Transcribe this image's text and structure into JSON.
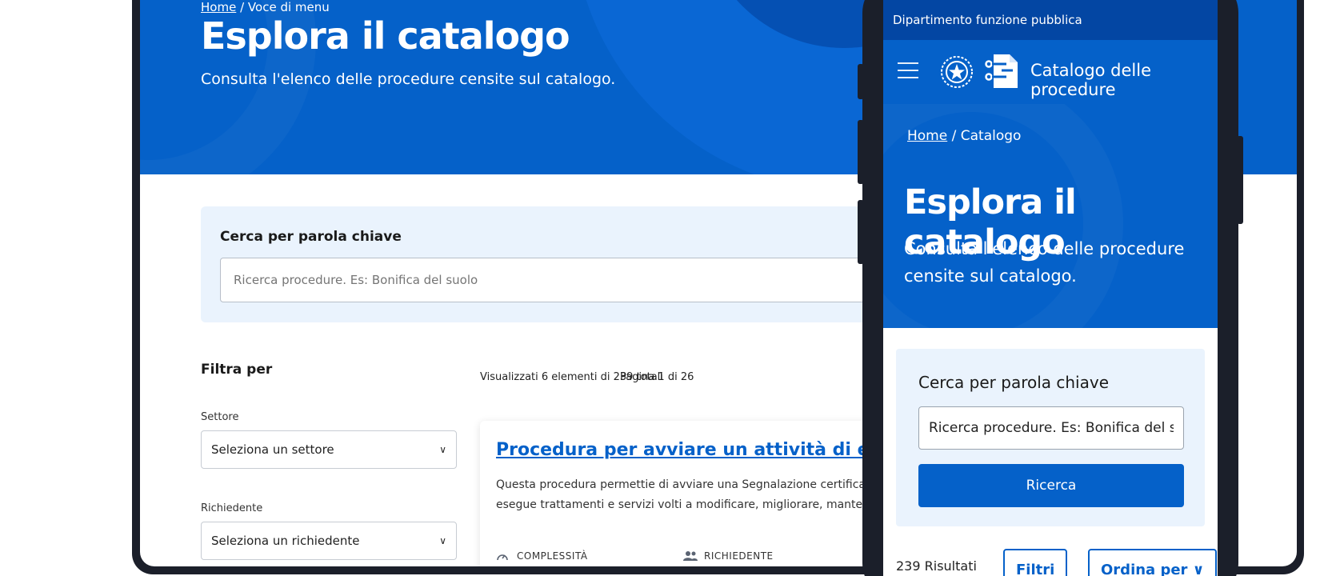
{
  "desktop": {
    "breadcrumb": {
      "home": "Home",
      "separator": "/",
      "current": "Voce di menu"
    },
    "title": "Esplora il catalogo",
    "subtitle": "Consulta l'elenco delle procedure censite sul catalogo.",
    "search": {
      "label": "Cerca per parola chiave",
      "placeholder": "Ricerca procedure. Es: Bonifica del suolo"
    },
    "filters": {
      "heading": "Filtra per",
      "settore": {
        "label": "Settore",
        "value": "Seleziona un settore"
      },
      "richiedente": {
        "label": "Richiedente",
        "value": "Seleziona un richiedente"
      }
    },
    "results": {
      "summary": "Visualizzati 6 elementi di 239 totali",
      "page": "Pagina 1 di 26"
    },
    "card": {
      "title": "Procedura per avviare un attività di estetista",
      "desc_line1": "Questa procedura permettie di avviare una Segnalazione certificata ne",
      "desc_line2": "esegue trattamenti e servizi volti a modificare, migliorare, mantenere",
      "meta_complessita": "COMPLESSITÀ",
      "meta_richiedente": "RICHIEDENTE"
    }
  },
  "mobile": {
    "top_bar": "Dipartimento funzione pubblica",
    "app_name": "Catalogo delle procedure",
    "breadcrumb": {
      "home": "Home",
      "separator": "/",
      "current": "Catalogo"
    },
    "title": "Esplora il catalogo",
    "subtitle": "Consulta l'elenco delle procedure censite sul catalogo.",
    "search": {
      "label": "Cerca per parola chiave",
      "value": "Ricerca procedure. Es: Bonifica del suolo",
      "button": "Ricerca"
    },
    "results_count": "239 Risultati",
    "filter_button": "Filtri",
    "sort_button": "Ordina per"
  },
  "colors": {
    "primary": "#0561c9",
    "dark_blue": "#0346a3",
    "light_bg": "#eaf3fd",
    "frame": "#1b1f2a"
  }
}
